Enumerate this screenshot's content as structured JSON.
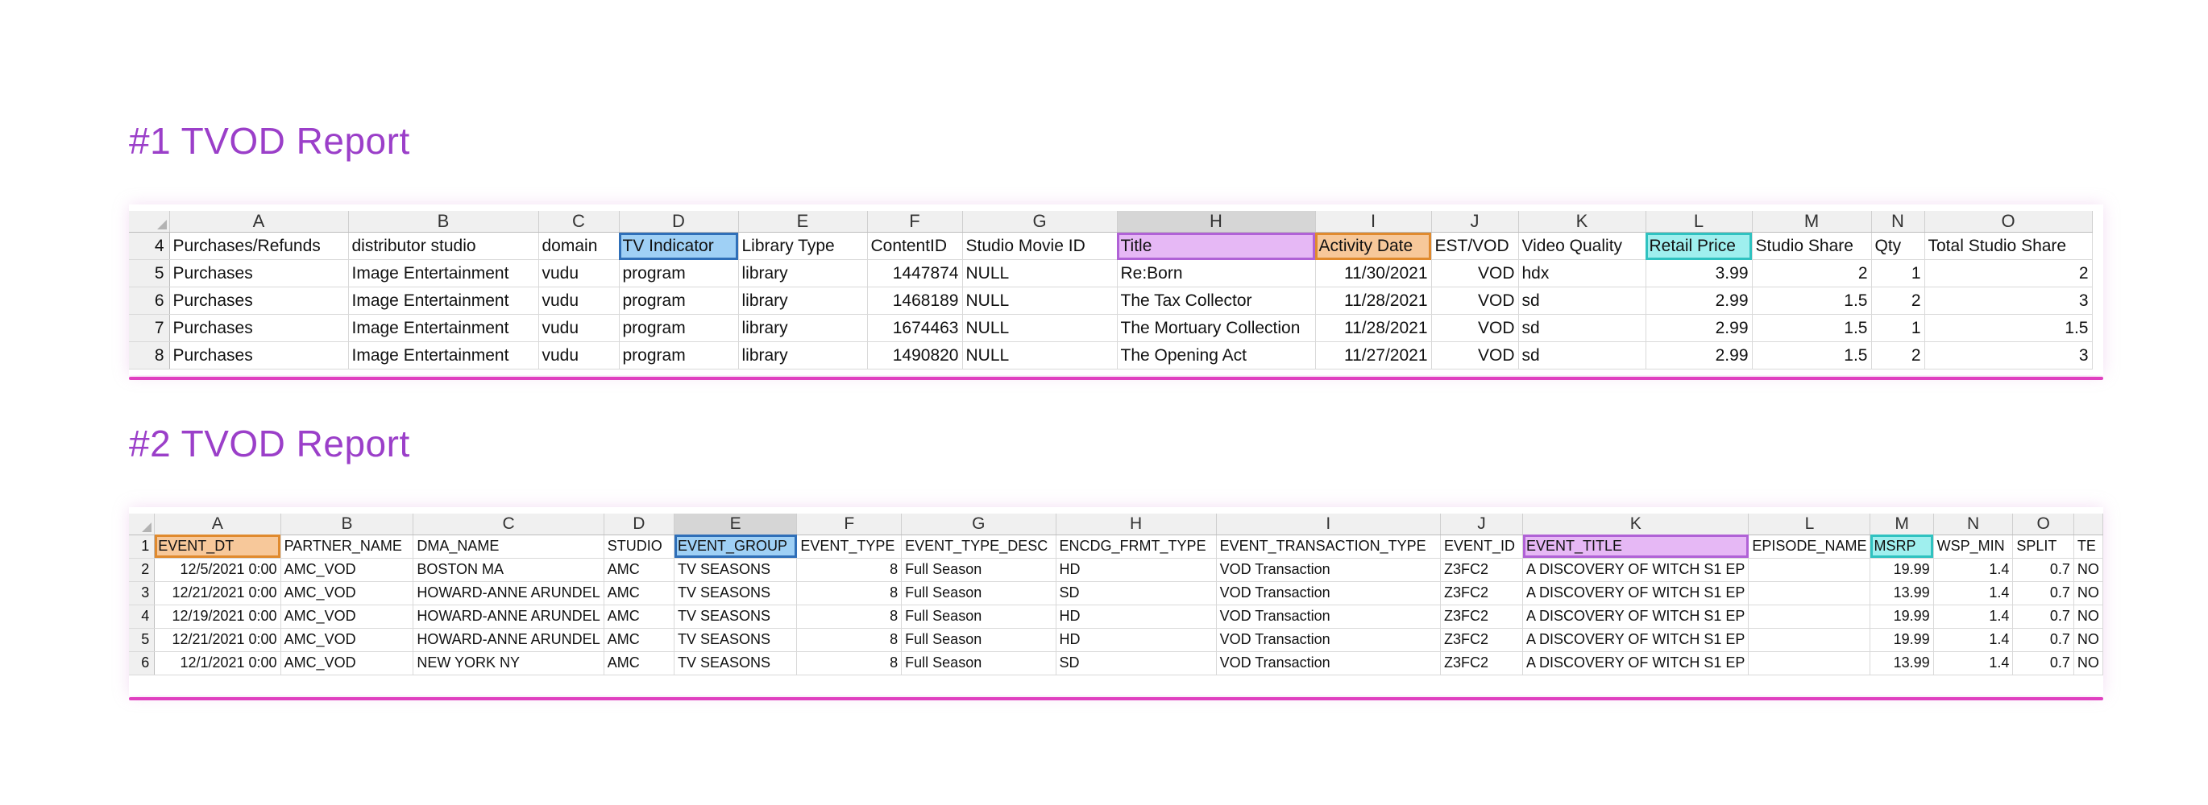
{
  "colors": {
    "title": "#9b3fc9",
    "underline": "#e040c0",
    "highlight_blue": "#9fd0f5",
    "highlight_purple": "#e6b8f5",
    "highlight_orange": "#f7c89a",
    "highlight_cyan": "#9fefee"
  },
  "report1": {
    "title": "#1 TVOD Report",
    "columns": [
      "A",
      "B",
      "C",
      "D",
      "E",
      "F",
      "G",
      "H",
      "I",
      "J",
      "K",
      "L",
      "M",
      "N",
      "O"
    ],
    "header_row": {
      "num": "4",
      "cells": [
        "Purchases/Refunds",
        "distributor studio",
        "domain",
        "TV Indicator",
        "Library Type",
        "ContentID",
        "Studio Movie ID",
        "Title",
        "Activity Date",
        "EST/VOD",
        "Video Quality",
        "Retail Price",
        "Studio Share",
        "Qty",
        "Total Studio Share"
      ]
    },
    "rows": [
      {
        "num": "5",
        "cells": [
          "Purchases",
          "Image Entertainment",
          "vudu",
          "program",
          "library",
          "1447874",
          "NULL",
          "Re:Born",
          "11/30/2021",
          "VOD",
          "hdx",
          "3.99",
          "2",
          "1",
          "2"
        ]
      },
      {
        "num": "6",
        "cells": [
          "Purchases",
          "Image Entertainment",
          "vudu",
          "program",
          "library",
          "1468189",
          "NULL",
          "The Tax Collector",
          "11/28/2021",
          "VOD",
          "sd",
          "2.99",
          "1.5",
          "2",
          "3"
        ]
      },
      {
        "num": "7",
        "cells": [
          "Purchases",
          "Image Entertainment",
          "vudu",
          "program",
          "library",
          "1674463",
          "NULL",
          "The Mortuary Collection",
          "11/28/2021",
          "VOD",
          "sd",
          "2.99",
          "1.5",
          "1",
          "1.5"
        ]
      },
      {
        "num": "8",
        "cells": [
          "Purchases",
          "Image Entertainment",
          "vudu",
          "program",
          "library",
          "1490820",
          "NULL",
          "The Opening Act",
          "11/27/2021",
          "VOD",
          "sd",
          "2.99",
          "1.5",
          "2",
          "3"
        ]
      }
    ]
  },
  "report2": {
    "title": "#2 TVOD Report",
    "columns": [
      "A",
      "B",
      "C",
      "D",
      "E",
      "F",
      "G",
      "H",
      "I",
      "J",
      "K",
      "L",
      "M",
      "N",
      "O",
      ""
    ],
    "header_row": {
      "num": "1",
      "cells": [
        "EVENT_DT",
        "PARTNER_NAME",
        "DMA_NAME",
        "STUDIO",
        "EVENT_GROUP",
        "EVENT_TYPE",
        "EVENT_TYPE_DESC",
        "ENCDG_FRMT_TYPE",
        "EVENT_TRANSACTION_TYPE",
        "EVENT_ID",
        "EVENT_TITLE",
        "EPISODE_NAME",
        "MSRP",
        "WSP_MIN",
        "SPLIT",
        "TE"
      ]
    },
    "rows": [
      {
        "num": "2",
        "cells": [
          "12/5/2021 0:00",
          "AMC_VOD",
          "BOSTON MA",
          "AMC",
          "TV SEASONS",
          "8",
          "Full Season",
          "HD",
          "VOD Transaction",
          "Z3FC2",
          "A DISCOVERY OF WITCH S1 EP",
          "",
          "19.99",
          "1.4",
          "0.7",
          "NO"
        ]
      },
      {
        "num": "3",
        "cells": [
          "12/21/2021 0:00",
          "AMC_VOD",
          "HOWARD-ANNE ARUNDEL",
          "AMC",
          "TV SEASONS",
          "8",
          "Full Season",
          "SD",
          "VOD Transaction",
          "Z3FC2",
          "A DISCOVERY OF WITCH S1 EP",
          "",
          "13.99",
          "1.4",
          "0.7",
          "NO"
        ]
      },
      {
        "num": "4",
        "cells": [
          "12/19/2021 0:00",
          "AMC_VOD",
          "HOWARD-ANNE ARUNDEL",
          "AMC",
          "TV SEASONS",
          "8",
          "Full Season",
          "HD",
          "VOD Transaction",
          "Z3FC2",
          "A DISCOVERY OF WITCH S1 EP",
          "",
          "19.99",
          "1.4",
          "0.7",
          "NO"
        ]
      },
      {
        "num": "5",
        "cells": [
          "12/21/2021 0:00",
          "AMC_VOD",
          "HOWARD-ANNE ARUNDEL",
          "AMC",
          "TV SEASONS",
          "8",
          "Full Season",
          "HD",
          "VOD Transaction",
          "Z3FC2",
          "A DISCOVERY OF WITCH S1 EP",
          "",
          "19.99",
          "1.4",
          "0.7",
          "NO"
        ]
      },
      {
        "num": "6",
        "cells": [
          "12/1/2021 0:00",
          "AMC_VOD",
          "NEW YORK NY",
          "AMC",
          "TV SEASONS",
          "8",
          "Full Season",
          "SD",
          "VOD Transaction",
          "Z3FC2",
          "A DISCOVERY OF WITCH S1 EP",
          "",
          "13.99",
          "1.4",
          "0.7",
          "NO"
        ]
      }
    ]
  }
}
